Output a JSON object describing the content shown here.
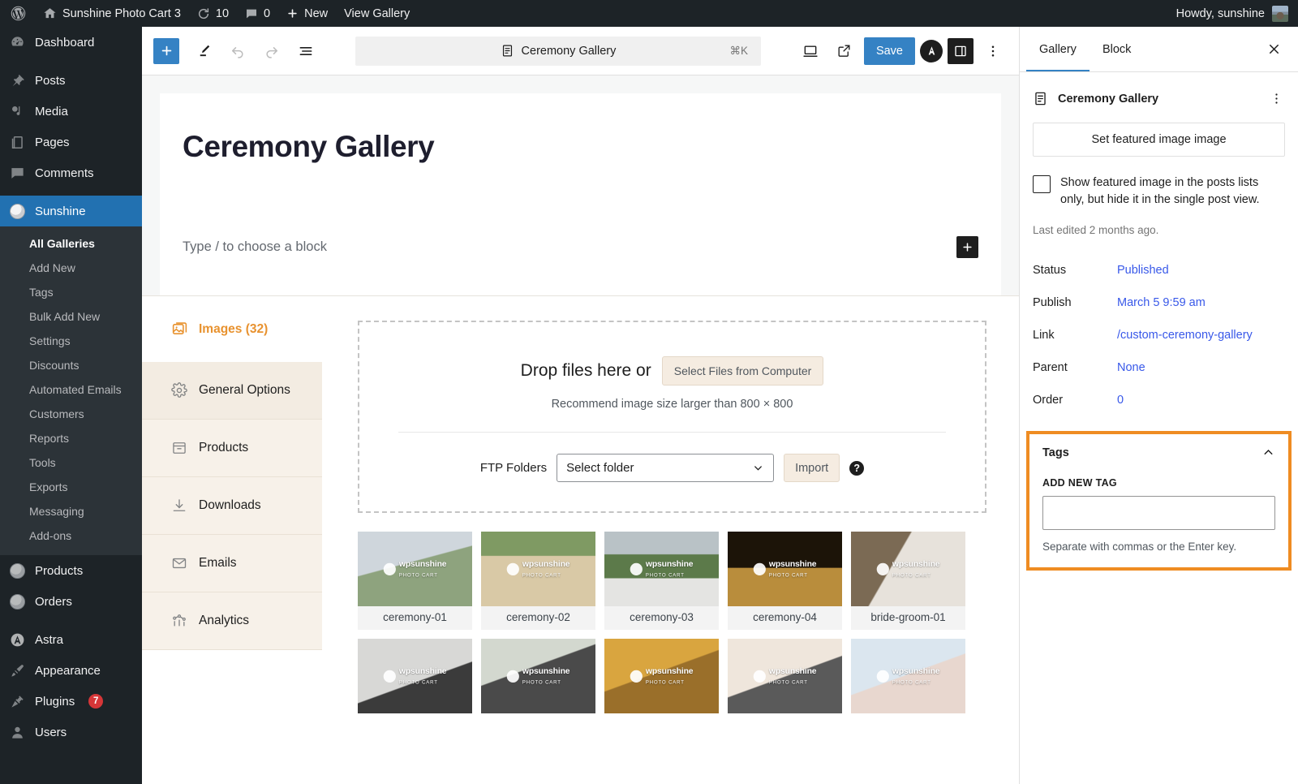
{
  "adminbar": {
    "site_name": "Sunshine Photo Cart 3",
    "updates_count": "10",
    "comments_count": "0",
    "new_label": "New",
    "view_gallery_label": "View Gallery",
    "howdy": "Howdy, sunshine"
  },
  "adminmenu": {
    "top": [
      {
        "label": "Dashboard",
        "icon": "dashboard-icon"
      },
      {
        "label": "Posts",
        "icon": "pin-icon"
      },
      {
        "label": "Media",
        "icon": "media-icon"
      },
      {
        "label": "Pages",
        "icon": "pages-icon"
      },
      {
        "label": "Comments",
        "icon": "comments-icon"
      }
    ],
    "sunshine": {
      "label": "Sunshine",
      "icon": "sunshine-icon"
    },
    "sunshine_sub": [
      {
        "label": "All Galleries",
        "current": true
      },
      {
        "label": "Add New",
        "current": false
      },
      {
        "label": "Tags",
        "current": false
      },
      {
        "label": "Bulk Add New",
        "current": false
      },
      {
        "label": "Settings",
        "current": false
      },
      {
        "label": "Discounts",
        "current": false
      },
      {
        "label": "Automated Emails",
        "current": false
      },
      {
        "label": "Customers",
        "current": false
      },
      {
        "label": "Reports",
        "current": false
      },
      {
        "label": "Tools",
        "current": false
      },
      {
        "label": "Exports",
        "current": false
      },
      {
        "label": "Messaging",
        "current": false
      },
      {
        "label": "Add-ons",
        "current": false
      }
    ],
    "after": [
      {
        "label": "Products",
        "icon": "sunshine-icon",
        "badge": ""
      },
      {
        "label": "Orders",
        "icon": "sunshine-icon",
        "badge": ""
      },
      {
        "label": "Astra",
        "icon": "astra-icon",
        "badge": ""
      },
      {
        "label": "Appearance",
        "icon": "brush-icon",
        "badge": ""
      },
      {
        "label": "Plugins",
        "icon": "plug-icon",
        "badge": "7"
      },
      {
        "label": "Users",
        "icon": "user-icon",
        "badge": ""
      }
    ]
  },
  "toolbar": {
    "add_block_icon": "plus-icon",
    "edit_tool_icon": "pencil-icon",
    "undo_icon": "undo-icon",
    "redo_icon": "redo-icon",
    "list_view_icon": "list-view-icon",
    "doc_title": "Ceremony Gallery",
    "doc_shortcut": "⌘K",
    "doc_icon": "document-icon",
    "preview_icon": "desktop-icon",
    "view_icon": "external-link-icon",
    "save_label": "Save",
    "astra_icon": "astra-icon",
    "sidebar_icon": "sidebar-toggle-icon",
    "options_icon": "kebab-icon"
  },
  "post": {
    "title": "Ceremony Gallery",
    "block_placeholder": "Type / to choose a block",
    "appender_icon": "plus-icon"
  },
  "gallery_box": {
    "images_tab": "Images (32)",
    "images_icon": "images-icon",
    "nav": [
      {
        "label": "General Options",
        "icon": "gear-icon",
        "active": true
      },
      {
        "label": "Products",
        "icon": "box-icon",
        "active": false
      },
      {
        "label": "Downloads",
        "icon": "download-icon",
        "active": false
      },
      {
        "label": "Emails",
        "icon": "envelope-icon",
        "active": false
      },
      {
        "label": "Analytics",
        "icon": "analytics-icon",
        "active": false
      }
    ],
    "dropzone": {
      "drop_text": "Drop files here or",
      "select_button": "Select Files from Computer",
      "recommend": "Recommend image size larger than 800 × 800",
      "ftp_label": "FTP Folders",
      "ftp_select_value": "Select folder",
      "import_button": "Import",
      "help_icon": "help-icon"
    },
    "thumbs": [
      {
        "caption": "ceremony-01",
        "bg": "linear-gradient(165deg,#cfd6dc 0 42%,#8ea37e 43% 100%)"
      },
      {
        "caption": "ceremony-02",
        "bg": "linear-gradient(180deg,#7f9a63 0 32%,#d9c9a6 33% 100%)"
      },
      {
        "caption": "ceremony-03",
        "bg": "linear-gradient(180deg,#b9c2c6 0 30%,#5c7a4a 31% 62%,#e4e4e2 63% 100%)"
      },
      {
        "caption": "ceremony-04",
        "bg": "linear-gradient(180deg,#1c1408 0 48%,#b98d3c 49% 100%)"
      },
      {
        "caption": "bride-groom-01",
        "bg": "linear-gradient(120deg,#7b6a54 0 38%,#e7e2db 39% 100%)"
      },
      {
        "caption": "",
        "bg": "linear-gradient(160deg,#d8d8d6 0 55%,#3b3b3b 56% 100%)"
      },
      {
        "caption": "",
        "bg": "linear-gradient(160deg,#d3d8cf 0 40%,#4a4a4a 41% 100%)"
      },
      {
        "caption": "",
        "bg": "linear-gradient(160deg,#d9a53f 0 45%,#9a6f2a 46% 100%)"
      },
      {
        "caption": "",
        "bg": "linear-gradient(160deg,#efe6dc 0 50%,#5a5a5a 51% 100%)"
      },
      {
        "caption": "",
        "bg": "linear-gradient(160deg,#dbe6ef 0 48%,#e8d7cf 49% 100%)"
      }
    ],
    "watermark": {
      "line1": "wpsunshine",
      "line2": "PHOTO CART"
    }
  },
  "inspector": {
    "tabs": [
      {
        "label": "Gallery",
        "active": true
      },
      {
        "label": "Block",
        "active": false
      }
    ],
    "close_icon": "close-icon",
    "doc_title": "Ceremony Gallery",
    "doc_icon": "document-icon",
    "kebab_icon": "kebab-icon",
    "featured_button": "Set featured image image",
    "featured_checkbox_label": "Show featured image in the posts lists only, but hide it in the single post view.",
    "last_edited": "Last edited 2 months ago.",
    "meta": [
      {
        "key": "Status",
        "value": "Published"
      },
      {
        "key": "Publish",
        "value": "March 5 9:59 am"
      },
      {
        "key": "Link",
        "value": "/custom-ceremony-gallery"
      },
      {
        "key": "Parent",
        "value": "None"
      },
      {
        "key": "Order",
        "value": "0"
      }
    ],
    "tags": {
      "title": "Tags",
      "collapse_icon": "chevron-up-icon",
      "add_label": "ADD NEW TAG",
      "input_value": "",
      "input_placeholder": "",
      "help": "Separate with commas or the Enter key.",
      "highlight_color": "#ef8c22"
    }
  },
  "colors": {
    "wp_blue": "#3582c4",
    "admin_dark": "#1d2327",
    "sunshine_orange": "#e8922f",
    "link_blue": "#3858e9"
  }
}
